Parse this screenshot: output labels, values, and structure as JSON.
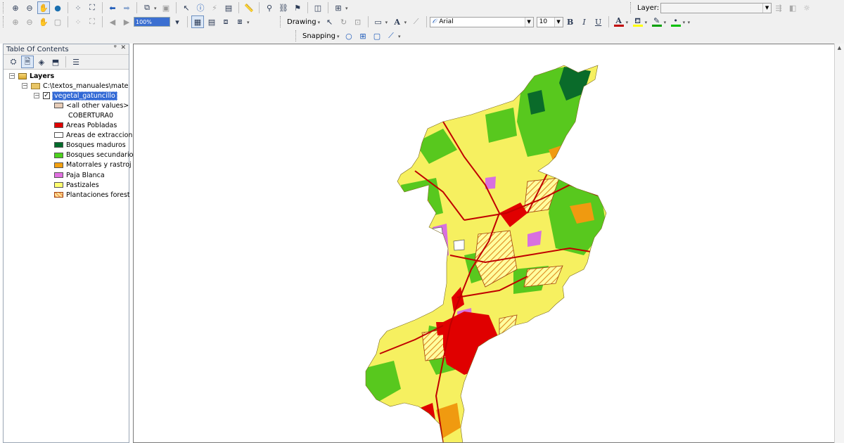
{
  "toolbar": {
    "layer_label": "Layer:",
    "layer_value": "",
    "zoom_scale": "100%",
    "drawing_label": "Drawing",
    "font_name": "Arial",
    "font_size": "10",
    "bold": "B",
    "italic": "I",
    "underline": "U",
    "text_color_glyph": "A",
    "snapping_label": "Snapping",
    "colors": {
      "text": "#c00000",
      "fill": "#ffff00",
      "line": "#00a000",
      "marker": "#00c000"
    }
  },
  "toc": {
    "title": "Table Of Contents",
    "pin": "ᵠ",
    "close": "✕",
    "root": "Layers",
    "folder": "C:\\textos_manuales\\mate",
    "layer": "vegetal_gatuncillo",
    "field": "COBERTURA0",
    "other": "<all other values>",
    "legend": [
      {
        "label": "Areas Pobladas",
        "color": "#e00000"
      },
      {
        "label": "Areas de extraccion",
        "color": "#ffffff"
      },
      {
        "label": "Bosques maduros",
        "color": "#006b2a"
      },
      {
        "label": "Bosques secundario",
        "color": "#4cd21e"
      },
      {
        "label": "Matorrales y rastroj",
        "color": "#f3a010"
      },
      {
        "label": "Paja Blanca",
        "color": "#e070e0"
      },
      {
        "label": "Pastizales",
        "color": "#ffff70"
      },
      {
        "label": "Plantaciones forest",
        "color": "#f3a55a"
      }
    ],
    "other_color": "#e6ccb8"
  }
}
